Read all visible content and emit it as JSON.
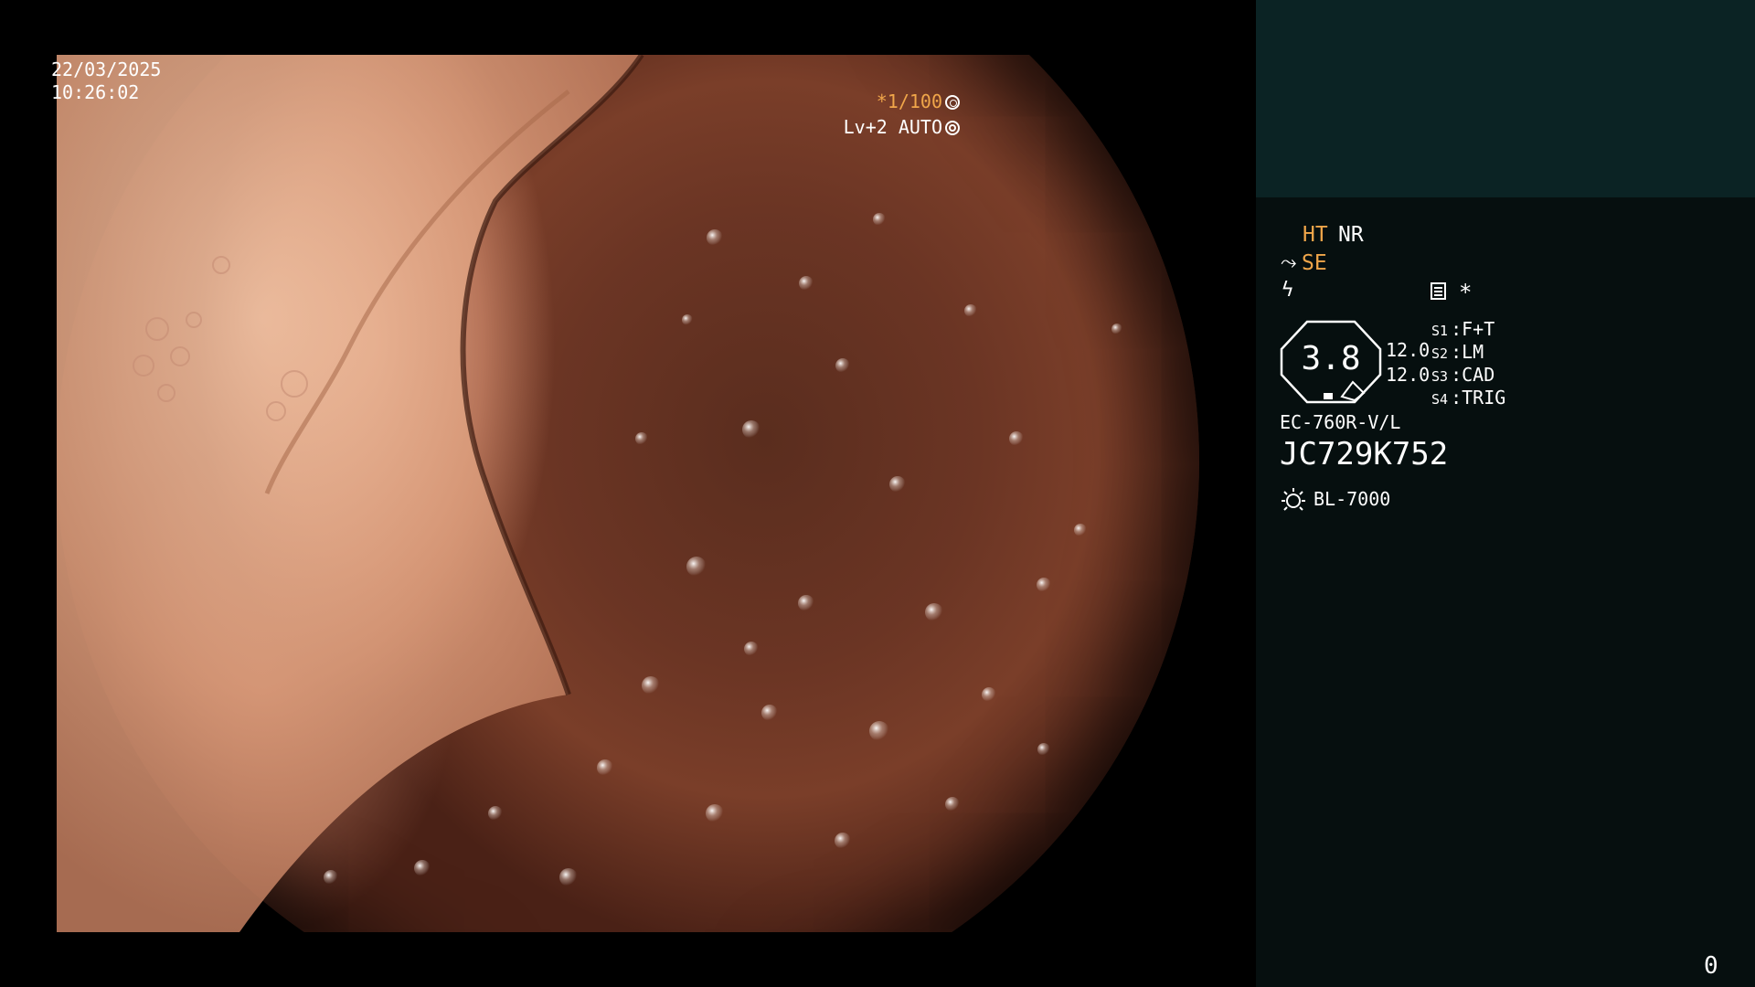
{
  "overlay": {
    "date": "22/03/2025",
    "time": "10:26:02",
    "shutter": "*1/100",
    "level": "Lv+2 AUTO"
  },
  "panel": {
    "mode_ht": "HT",
    "mode_nr": "NR",
    "mode_se": "SE",
    "star": "*",
    "scale_value": "3.8",
    "scale_numbers": [
      "12.0",
      "12.0"
    ],
    "switches": [
      {
        "key": "S1",
        "value": "F+T"
      },
      {
        "key": "S2",
        "value": "LM"
      },
      {
        "key": "S3",
        "value": "CAD"
      },
      {
        "key": "S4",
        "value": "TRIG"
      }
    ],
    "scope_model": "EC-760R-V/L",
    "scope_serial": "JC729K752",
    "light_source": "BL-7000",
    "counter": "0"
  },
  "colors": {
    "accent": "#f0a64a",
    "panel_bg": "#060f0f",
    "thumb_bg": "#0b2324"
  },
  "icons": [
    "shutter-icon",
    "auto-icon",
    "se-icon",
    "lightning-icon",
    "memo-icon",
    "star-icon",
    "lamp-icon"
  ]
}
